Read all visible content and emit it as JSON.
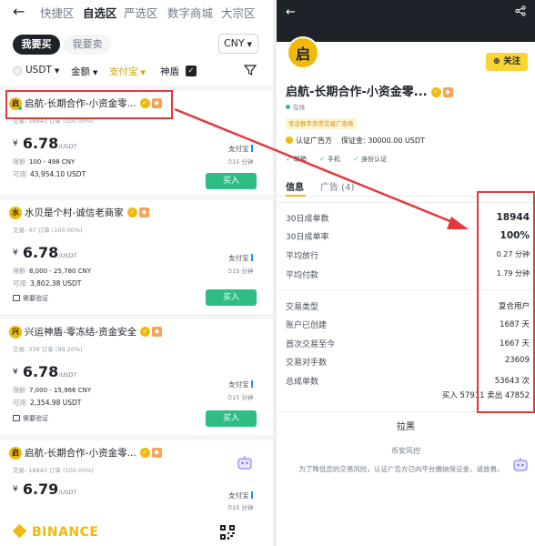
{
  "left": {
    "top_nav": {
      "back_icon": "back-arrow-icon",
      "tabs": [
        {
          "label": "快捷区",
          "active": false
        },
        {
          "label": "自选区",
          "active": true
        },
        {
          "label": "严选区",
          "active": false
        },
        {
          "label": "数字商城",
          "active": false
        },
        {
          "label": "大宗区",
          "active": false
        }
      ]
    },
    "trade_toggle": {
      "buy_label": "我要买",
      "sell_label": "我要卖"
    },
    "currency": "CNY",
    "filters": {
      "coin": "USDT",
      "amount": "金额",
      "payment": "支付宝",
      "shield": "神盾",
      "filter_icon": "funnel-icon"
    },
    "ads": [
      {
        "avatar": "启",
        "name": "启航-长期合作-小资金零...",
        "stats": "交易: 18943 订单 (100.00%)",
        "currency_symbol": "¥",
        "price": "6.78",
        "price_unit": "/USDT",
        "limit_label": "限额",
        "limit": "100 - 498 CNY",
        "available_label": "可用",
        "available": "43,954.10 USDT",
        "payment": "支付宝",
        "time": "15 分钟",
        "button": "买入",
        "verify": ""
      },
      {
        "avatar": "水",
        "name": "水贝是个村-诚信老商家",
        "stats": "交易: 47 订单 (100.00%)",
        "currency_symbol": "¥",
        "price": "6.78",
        "price_unit": "/USDT",
        "limit_label": "限额",
        "limit": "8,000 - 25,780 CNY",
        "available_label": "可用",
        "available": "3,802.38 USDT",
        "payment": "支付宝",
        "time": "15 分钟",
        "button": "买入",
        "verify": "需要验证"
      },
      {
        "avatar": "兴",
        "name": "兴运神盾-零冻结-资金安全",
        "stats": "交易: 339 订单 (99.20%)",
        "currency_symbol": "¥",
        "price": "6.78",
        "price_unit": "/USDT",
        "limit_label": "限额",
        "limit": "7,000 - 15,966 CNY",
        "available_label": "可用",
        "available": "2,354.98 USDT",
        "payment": "支付宝",
        "time": "15 分钟",
        "button": "买入",
        "verify": "需要验证"
      },
      {
        "avatar": "启",
        "name": "启航-长期合作-小资金零...",
        "stats": "交易: 18943 订单 (100.00%)",
        "currency_symbol": "¥",
        "price": "6.79",
        "price_unit": "/USDT",
        "payment": "支付宝",
        "time": "15 分钟"
      }
    ],
    "footer": {
      "brand": "BINANCE"
    }
  },
  "right": {
    "avatar": "启",
    "follow_label": "关注",
    "name": "启航-长期合作-小资金零...",
    "online": "在线",
    "tag": "专业数字货币交易广告商",
    "certified": "认证广告方",
    "deposit": "保证金: 30000.00 USDT",
    "checks": [
      "邮箱",
      "手机",
      "身份认证"
    ],
    "tabs": {
      "info": "信息",
      "ads": "广告 (4)"
    },
    "stats_a": [
      {
        "label": "30日成单数",
        "value": "18944",
        "style": "bold"
      },
      {
        "label": "30日成单率",
        "value": "100%",
        "style": "bold"
      },
      {
        "label": "平均放行",
        "value": "0.27 分钟",
        "style": "small"
      },
      {
        "label": "平均付款",
        "value": "1.79 分钟",
        "style": "small"
      }
    ],
    "stats_b": [
      {
        "label": "交易类型",
        "value": "复合用户",
        "style": "med"
      },
      {
        "label": "账户已创建",
        "value": "1687 天",
        "style": "med"
      },
      {
        "label": "首次交易至今",
        "value": "1667 天",
        "style": "med"
      },
      {
        "label": "交易对手数",
        "value": "23609",
        "style": "med"
      },
      {
        "label": "总成单数",
        "value": "53643 次",
        "style": "med"
      }
    ],
    "buy_sell": "买入 57911 卖出 47852",
    "blacklist": "拉黑",
    "risk_title": "币安风控",
    "risk_text": "为了降低您的交易风险，认证广告方已向平台缴纳保证金，请放易。"
  },
  "colors": {
    "brand_yellow": "#f0b90b",
    "buy_green": "#2ebd85",
    "annotation_red": "#e5383b",
    "text_dark": "#1e2329"
  }
}
